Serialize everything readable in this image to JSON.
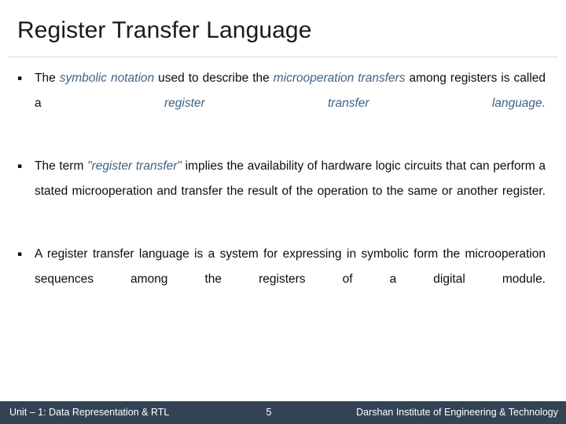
{
  "slide": {
    "title": "Register Transfer Language",
    "bullet_marker": "▪",
    "accent_color": "#3f6382",
    "footer_bar_color": "#334355",
    "body_text_color": "#0d0d0d",
    "bullets": [
      {
        "id": "bullet-symbolic-notation",
        "runs": [
          {
            "text": "The ",
            "style": "plain"
          },
          {
            "text": "symbolic notation",
            "style": "emphasis"
          },
          {
            "text": " used to describe the ",
            "style": "plain"
          },
          {
            "text": "microoperation transfers",
            "style": "emphasis"
          },
          {
            "text": " among registers is called a ",
            "style": "plain"
          },
          {
            "text": "register transfer language",
            "style": "emphasis"
          },
          {
            "text": ".",
            "style": "emphasis"
          }
        ]
      },
      {
        "id": "bullet-register-transfer-term",
        "runs": [
          {
            "text": "The term ",
            "style": "plain"
          },
          {
            "text": "\"register transfer\"",
            "style": "emphasis"
          },
          {
            "text": " implies the availability of hardware logic circuits that can perform a stated microoperation and transfer the result of the operation to the same or another register.",
            "style": "plain"
          }
        ]
      },
      {
        "id": "bullet-rtl-definition",
        "runs": [
          {
            "text": "A register transfer language is a system for expressing in symbolic form the microoperation sequences among the registers of a digital module.",
            "style": "plain"
          }
        ]
      }
    ]
  },
  "footer": {
    "left": "Unit – 1: Data Representation & RTL",
    "page_number": "5",
    "right": "Darshan Institute of Engineering & Technology"
  }
}
